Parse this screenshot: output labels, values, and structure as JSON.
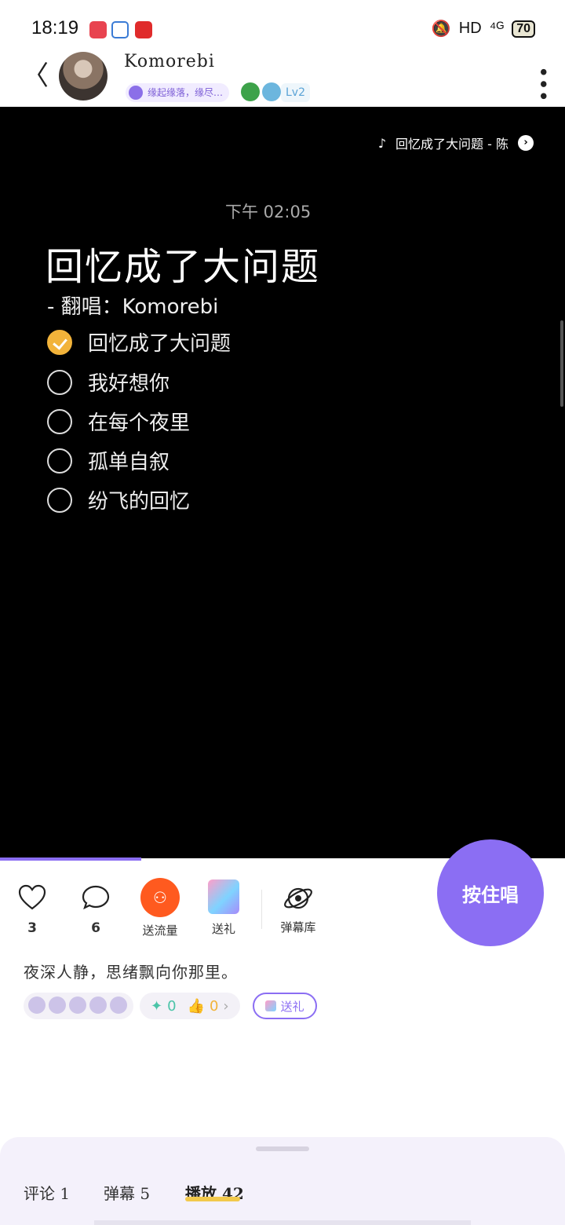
{
  "status_bar": {
    "time": "18:19",
    "network": "HD",
    "signal": "⁴ᴳ",
    "battery": "70"
  },
  "header": {
    "back_icon": "chevron-left-icon",
    "username": "Komorebi",
    "badge_text": "缘起缘落，缘尽…",
    "level": "Lv2"
  },
  "video": {
    "song_ticker": "回忆成了大问题 - 陈",
    "time": "下午 02:05",
    "title": "回忆成了大问题",
    "subtitle": "-  翻唱：Komorebi",
    "lyrics": [
      {
        "text": "回忆成了大问题",
        "checked": true
      },
      {
        "text": "我好想你",
        "checked": false
      },
      {
        "text": "在每个夜里",
        "checked": false
      },
      {
        "text": "孤单自叙",
        "checked": false
      },
      {
        "text": "纷飞的回忆",
        "checked": false
      }
    ],
    "progress_fraction": 0.25
  },
  "actions": {
    "like_count": "3",
    "comment_count": "6",
    "traffic_label": "送流量",
    "gift_label": "送礼",
    "danmaku_label": "弹幕库",
    "sing_button": "按住唱"
  },
  "caption": "夜深人静，思绪飘向你那里。",
  "gift_row": {
    "gems": "0",
    "thumbs": "0",
    "gift_button": "送礼"
  },
  "tabs": [
    {
      "label": "评论 1"
    },
    {
      "label": "弹幕 5"
    },
    {
      "label": "播放 42"
    }
  ],
  "colors": {
    "accent": "#8b6ef3",
    "check": "#f2b33a",
    "traffic": "#ff5a1f"
  }
}
